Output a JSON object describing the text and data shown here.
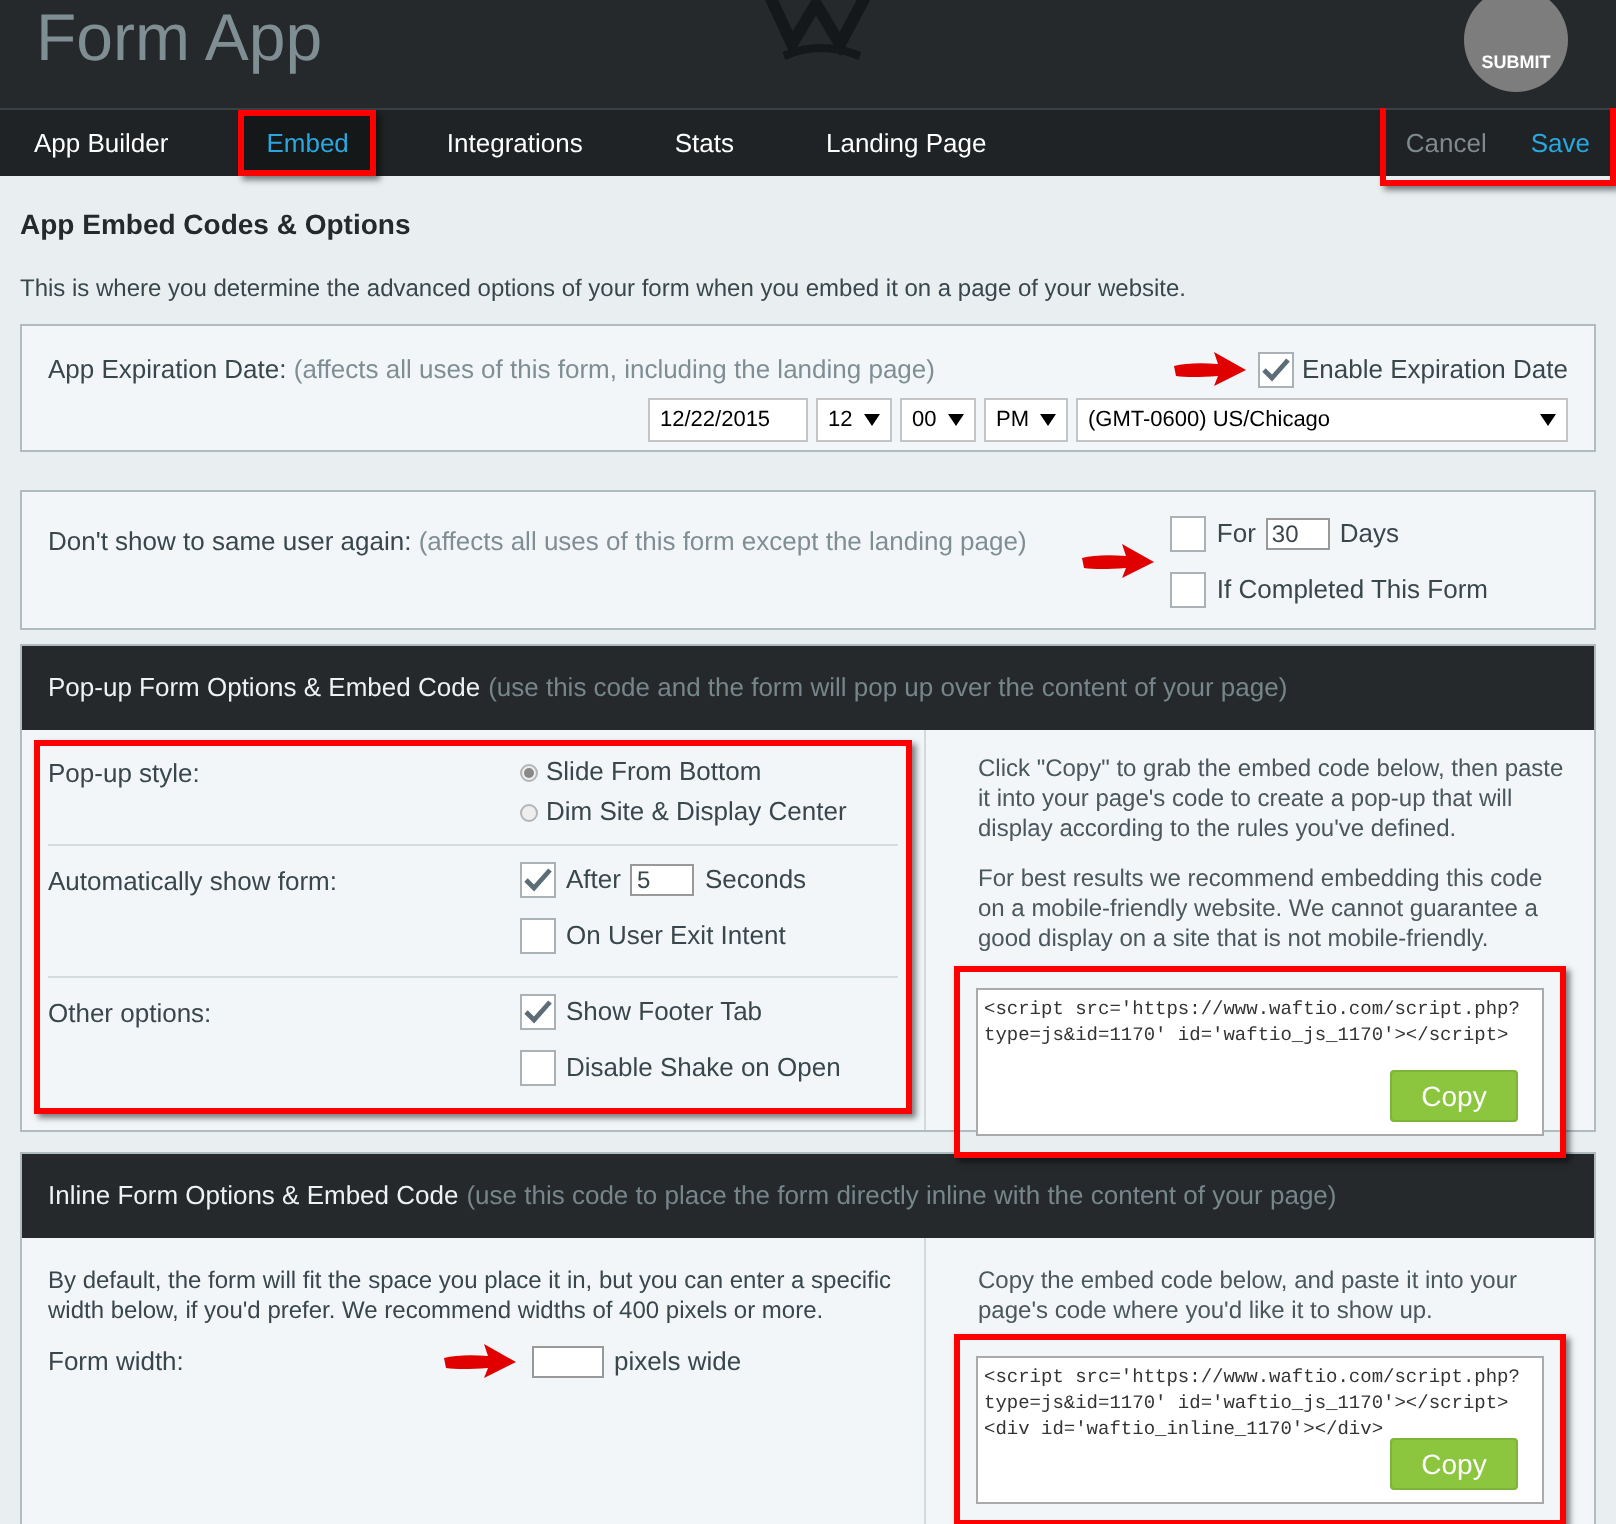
{
  "header": {
    "title": "Form App",
    "badge": "SUBMIT"
  },
  "tabs": [
    {
      "label": "App Builder",
      "selected": false
    },
    {
      "label": "Embed",
      "selected": true
    },
    {
      "label": "Integrations",
      "selected": false
    },
    {
      "label": "Stats",
      "selected": false
    },
    {
      "label": "Landing Page",
      "selected": false
    }
  ],
  "actions": [
    {
      "label": "Cancel",
      "kind": "cancel"
    },
    {
      "label": "Save",
      "kind": "save"
    }
  ],
  "page": {
    "heading": "App Embed Codes & Options",
    "intro": "This is where you determine the advanced options of your form when you embed it on a page of your website."
  },
  "expiration": {
    "label": "App Expiration Date:",
    "note": "(affects all uses of this form, including the landing page)",
    "checkbox": {
      "label": "Enable Expiration Date",
      "checked": true
    },
    "date": "12/22/2015",
    "hour": "12",
    "minute": "00",
    "ampm": "PM",
    "timezone": "(GMT-0600) US/Chicago"
  },
  "repeat": {
    "label": "Don't show to same user again:",
    "note": "(affects all uses of this form except the landing page)",
    "options": [
      {
        "kind": "check_input",
        "prefix": "For",
        "value": "30",
        "suffix": "Days",
        "checked": false
      },
      {
        "kind": "check",
        "label": "If Completed This Form",
        "checked": false
      }
    ]
  },
  "popup": {
    "title": "Pop-up Form Options & Embed Code",
    "note": "(use this code and the form will pop up over the content of your page)",
    "groups": [
      {
        "label": "Pop-up style:",
        "options": [
          {
            "kind": "radio",
            "label": "Slide From Bottom",
            "selected": true
          },
          {
            "kind": "radio",
            "label": "Dim Site & Display Center",
            "selected": false
          }
        ]
      },
      {
        "label": "Automatically show form:",
        "options": [
          {
            "kind": "check_input",
            "prefix": "After",
            "value": "5",
            "suffix": "Seconds",
            "checked": true
          },
          {
            "kind": "check",
            "label": "On User Exit Intent",
            "checked": false
          }
        ]
      },
      {
        "label": "Other options:",
        "options": [
          {
            "kind": "check",
            "label": "Show Footer Tab",
            "checked": true
          },
          {
            "kind": "check",
            "label": "Disable Shake on Open",
            "checked": false
          }
        ]
      }
    ],
    "instructions": [
      "Click \"Copy\" to grab the embed code below, then paste it into your page's code to create a pop-up that will display according to the rules you've defined.",
      "For best results we recommend embedding this code on a mobile-friendly website. We cannot guarantee a good display on a site that is not mobile-friendly."
    ],
    "code": "<script src='https://www.waftio.com/script.php?\ntype=js&id=1170' id='waftio_js_1170'></script>",
    "copy": "Copy"
  },
  "inline": {
    "title": "Inline Form Options & Embed Code",
    "note": "(use this code to place the form directly inline with the content of your page)",
    "intro": "By default, the form will fit the space you place it in, but you can enter a specific width below, if you'd prefer. We recommend widths of 400 pixels or more.",
    "width_label": "Form width:",
    "width_suffix": "pixels wide",
    "instructions": [
      "Copy the embed code below, and paste it into your page's code where you'd like it to show up."
    ],
    "code": "<script src='https://www.waftio.com/script.php?\ntype=js&id=1170' id='waftio_js_1170'></script>\n<div id='waftio_inline_1170'></div>",
    "copy": "Copy"
  }
}
